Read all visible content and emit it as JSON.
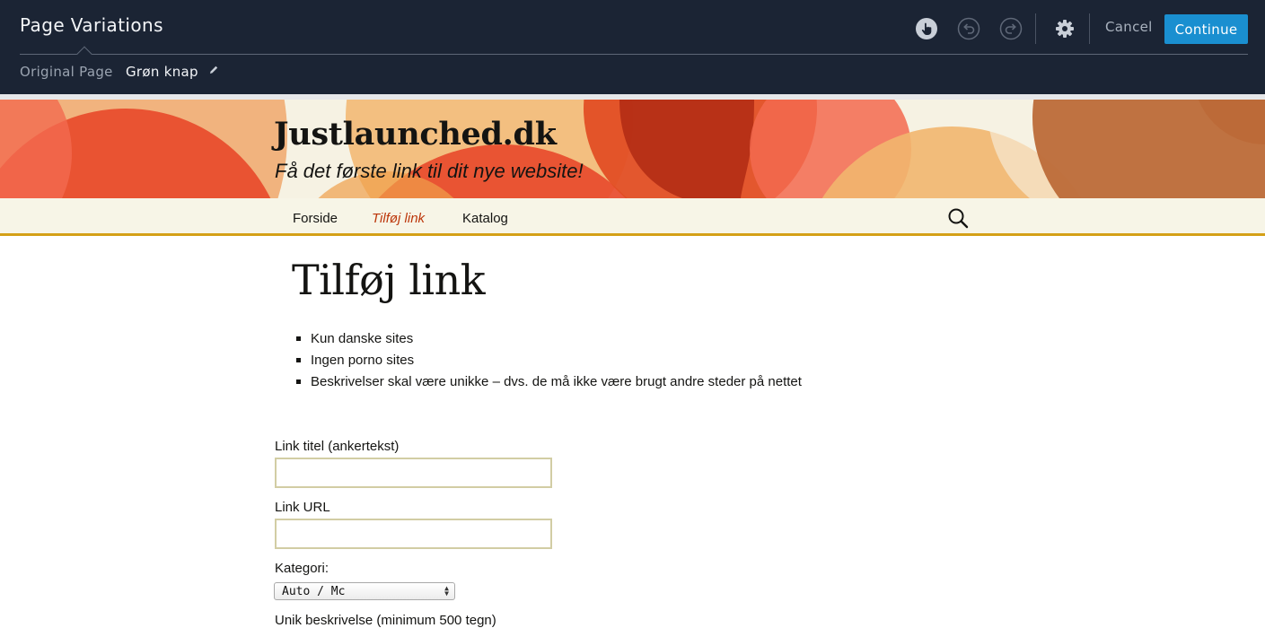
{
  "editor": {
    "title": "Page Variations",
    "variations": [
      {
        "label": "Original Page"
      },
      {
        "label": "Grøn knap"
      }
    ],
    "toolbar": {
      "icons": [
        "hand-pointer-icon",
        "undo-icon",
        "redo-icon",
        "gear-icon"
      ],
      "cancel_label": "Cancel",
      "continue_label": "Continue"
    },
    "colors": {
      "bar": "#1b2434",
      "primary_button": "#1a8fd0"
    }
  },
  "site": {
    "title": "Justlaunched.dk",
    "tagline": "Få det første link til dit nye website!",
    "nav": [
      {
        "label": "Forside"
      },
      {
        "label": "Tilføj link"
      },
      {
        "label": "Katalog"
      }
    ],
    "current_nav": "Tilføj link",
    "colors": {
      "accent": "#bc360a",
      "nav_border": "#d4a017"
    }
  },
  "content": {
    "heading": "Tilføj link",
    "rules": [
      "Kun danske sites",
      "Ingen porno sites",
      "Beskrivelser skal være unikke – dvs. de må ikke være brugt andre steder på nettet"
    ]
  },
  "form": {
    "title_label": "Link titel (ankertekst)",
    "title_value": "",
    "url_label": "Link URL",
    "url_value": "",
    "category_label": "Kategori:",
    "category_selected": "Auto / Mc",
    "description_label": "Unik beskrivelse (minimum 500 tegn)"
  }
}
